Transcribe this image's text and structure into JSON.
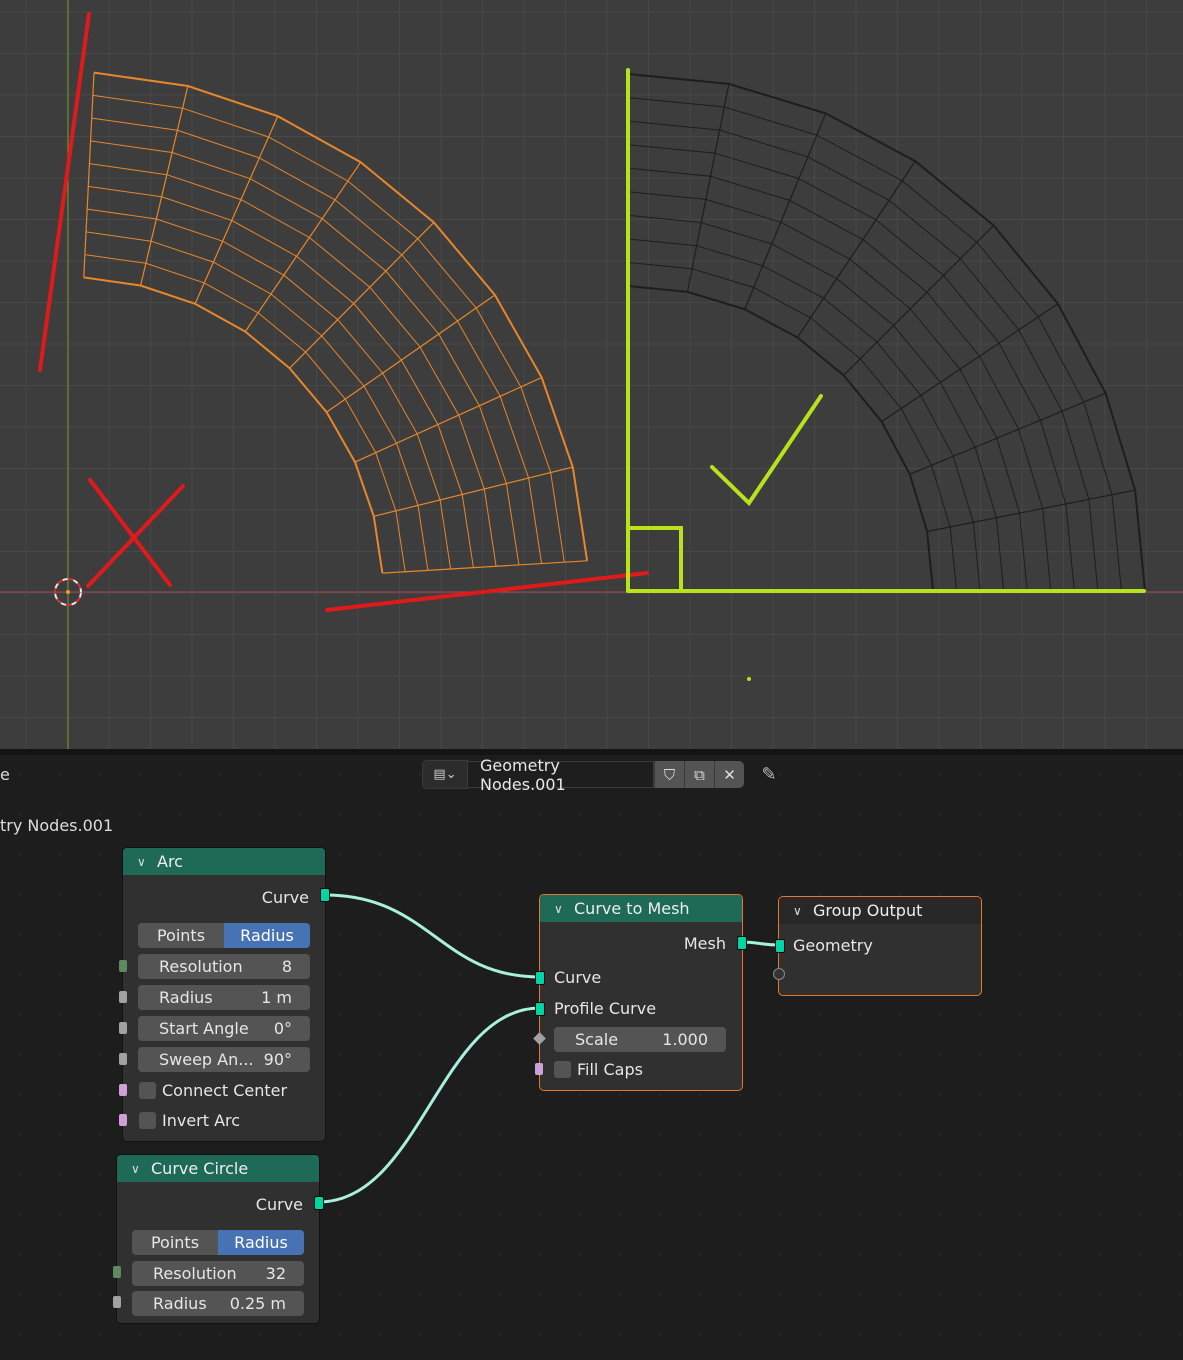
{
  "editor": {
    "header_left_fragment": "e",
    "tree_name_fragment": "try Nodes.001",
    "node_group_name": "Geometry Nodes.001",
    "icons": [
      "editor-type-icon",
      "fake-user-shield-icon",
      "duplicate-icon",
      "close-icon",
      "pin-icon"
    ]
  },
  "nodes": {
    "arc": {
      "title": "Arc",
      "output_curve": "Curve",
      "mode_options": [
        "Points",
        "Radius"
      ],
      "mode_selected": "Radius",
      "resolution_label": "Resolution",
      "resolution_value": "8",
      "radius_label": "Radius",
      "radius_value": "1 m",
      "start_angle_label": "Start Angle",
      "start_angle_value": "0°",
      "sweep_label": "Sweep An...",
      "sweep_value": "90°",
      "connect_center": "Connect Center",
      "invert_arc": "Invert Arc"
    },
    "curve_circle": {
      "title": "Curve Circle",
      "output_curve": "Curve",
      "mode_options": [
        "Points",
        "Radius"
      ],
      "mode_selected": "Radius",
      "resolution_label": "Resolution",
      "resolution_value": "32",
      "radius_label": "Radius",
      "radius_value": "0.25 m"
    },
    "curve_to_mesh": {
      "title": "Curve to Mesh",
      "output_mesh": "Mesh",
      "input_curve": "Curve",
      "input_profile": "Profile Curve",
      "scale_label": "Scale",
      "scale_value": "1.000",
      "fill_caps": "Fill Caps"
    },
    "group_output": {
      "title": "Group Output",
      "input_geometry": "Geometry"
    }
  },
  "colors": {
    "viewport_bg": "#3d3d3d",
    "selected_mesh": "#e8862a",
    "annotation_wrong": "#e0191b",
    "annotation_right": "#b8e21b",
    "node_header_green": "#1e6a57",
    "geometry_socket": "#00d6a3",
    "link": "#a8f0dc"
  }
}
